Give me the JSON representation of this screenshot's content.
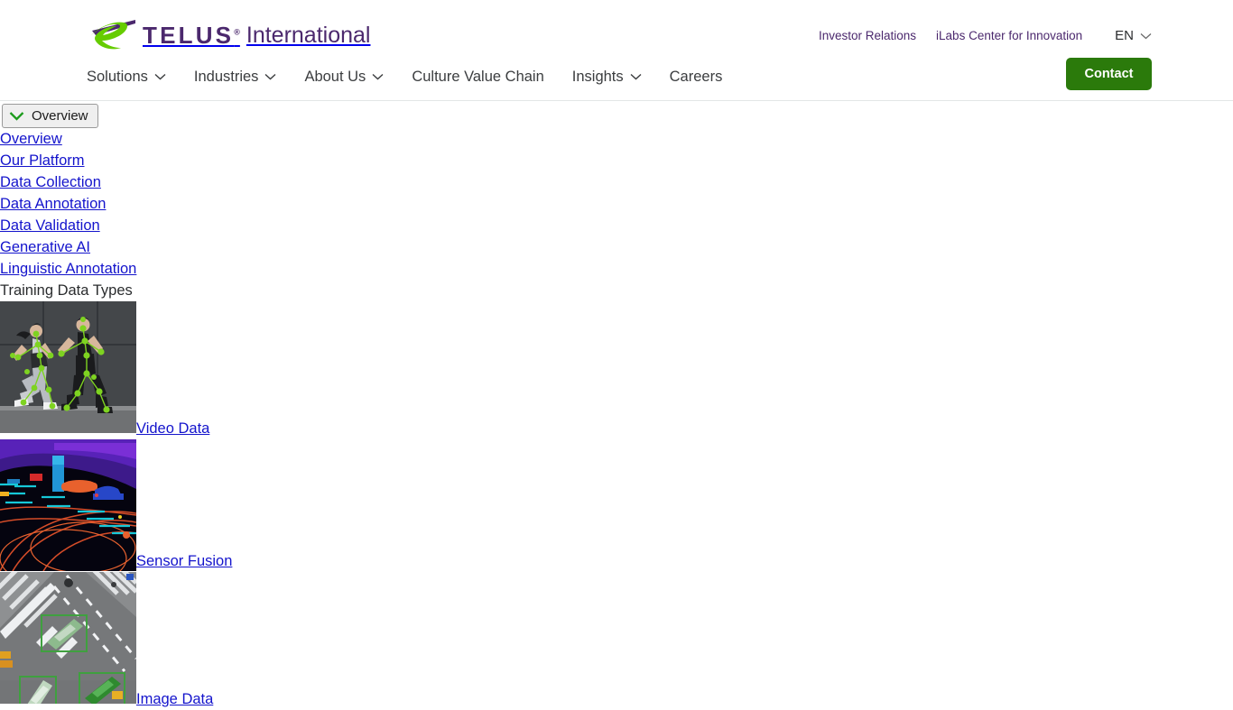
{
  "brand": {
    "logo_telus": "TELUS",
    "logo_registered": "®",
    "logo_international": "International",
    "logo_icon": "telus-swoosh-logo",
    "purple": "#4b286d",
    "green": "#66cc00"
  },
  "header": {
    "utility_links": [
      {
        "label": "Investor Relations"
      },
      {
        "label": "iLabs Center for Innovation"
      }
    ],
    "language": {
      "label": "EN",
      "icon": "chevron-down-icon"
    },
    "nav_items": [
      {
        "label": "Solutions",
        "has_dropdown": true
      },
      {
        "label": "Industries",
        "has_dropdown": true
      },
      {
        "label": "About Us",
        "has_dropdown": true
      },
      {
        "label": "Culture Value Chain",
        "has_dropdown": false
      },
      {
        "label": "Insights",
        "has_dropdown": true
      },
      {
        "label": "Careers",
        "has_dropdown": false
      }
    ],
    "contact_button": {
      "label": "Contact",
      "color": "#2b7a0b"
    }
  },
  "panel": {
    "toggle_button": {
      "label": "Overview",
      "icon": "chevron-down-icon"
    },
    "links": [
      {
        "label": "Overview"
      },
      {
        "label": "Our Platform"
      },
      {
        "label": "Data Collection"
      },
      {
        "label": "Data Annotation"
      },
      {
        "label": "Data Validation"
      },
      {
        "label": "Generative AI"
      },
      {
        "label": "Linguistic Annotation"
      }
    ],
    "section_heading": "Training Data Types",
    "cards": [
      {
        "label": "Video Data",
        "image_name": "video-data-pose-estimation-runners-thumbnail"
      },
      {
        "label": "Sensor Fusion",
        "image_name": "sensor-fusion-lidar-pointcloud-thumbnail"
      },
      {
        "label": "Image Data",
        "image_name": "aerial-intersection-bounding-boxes-thumbnail"
      }
    ]
  }
}
